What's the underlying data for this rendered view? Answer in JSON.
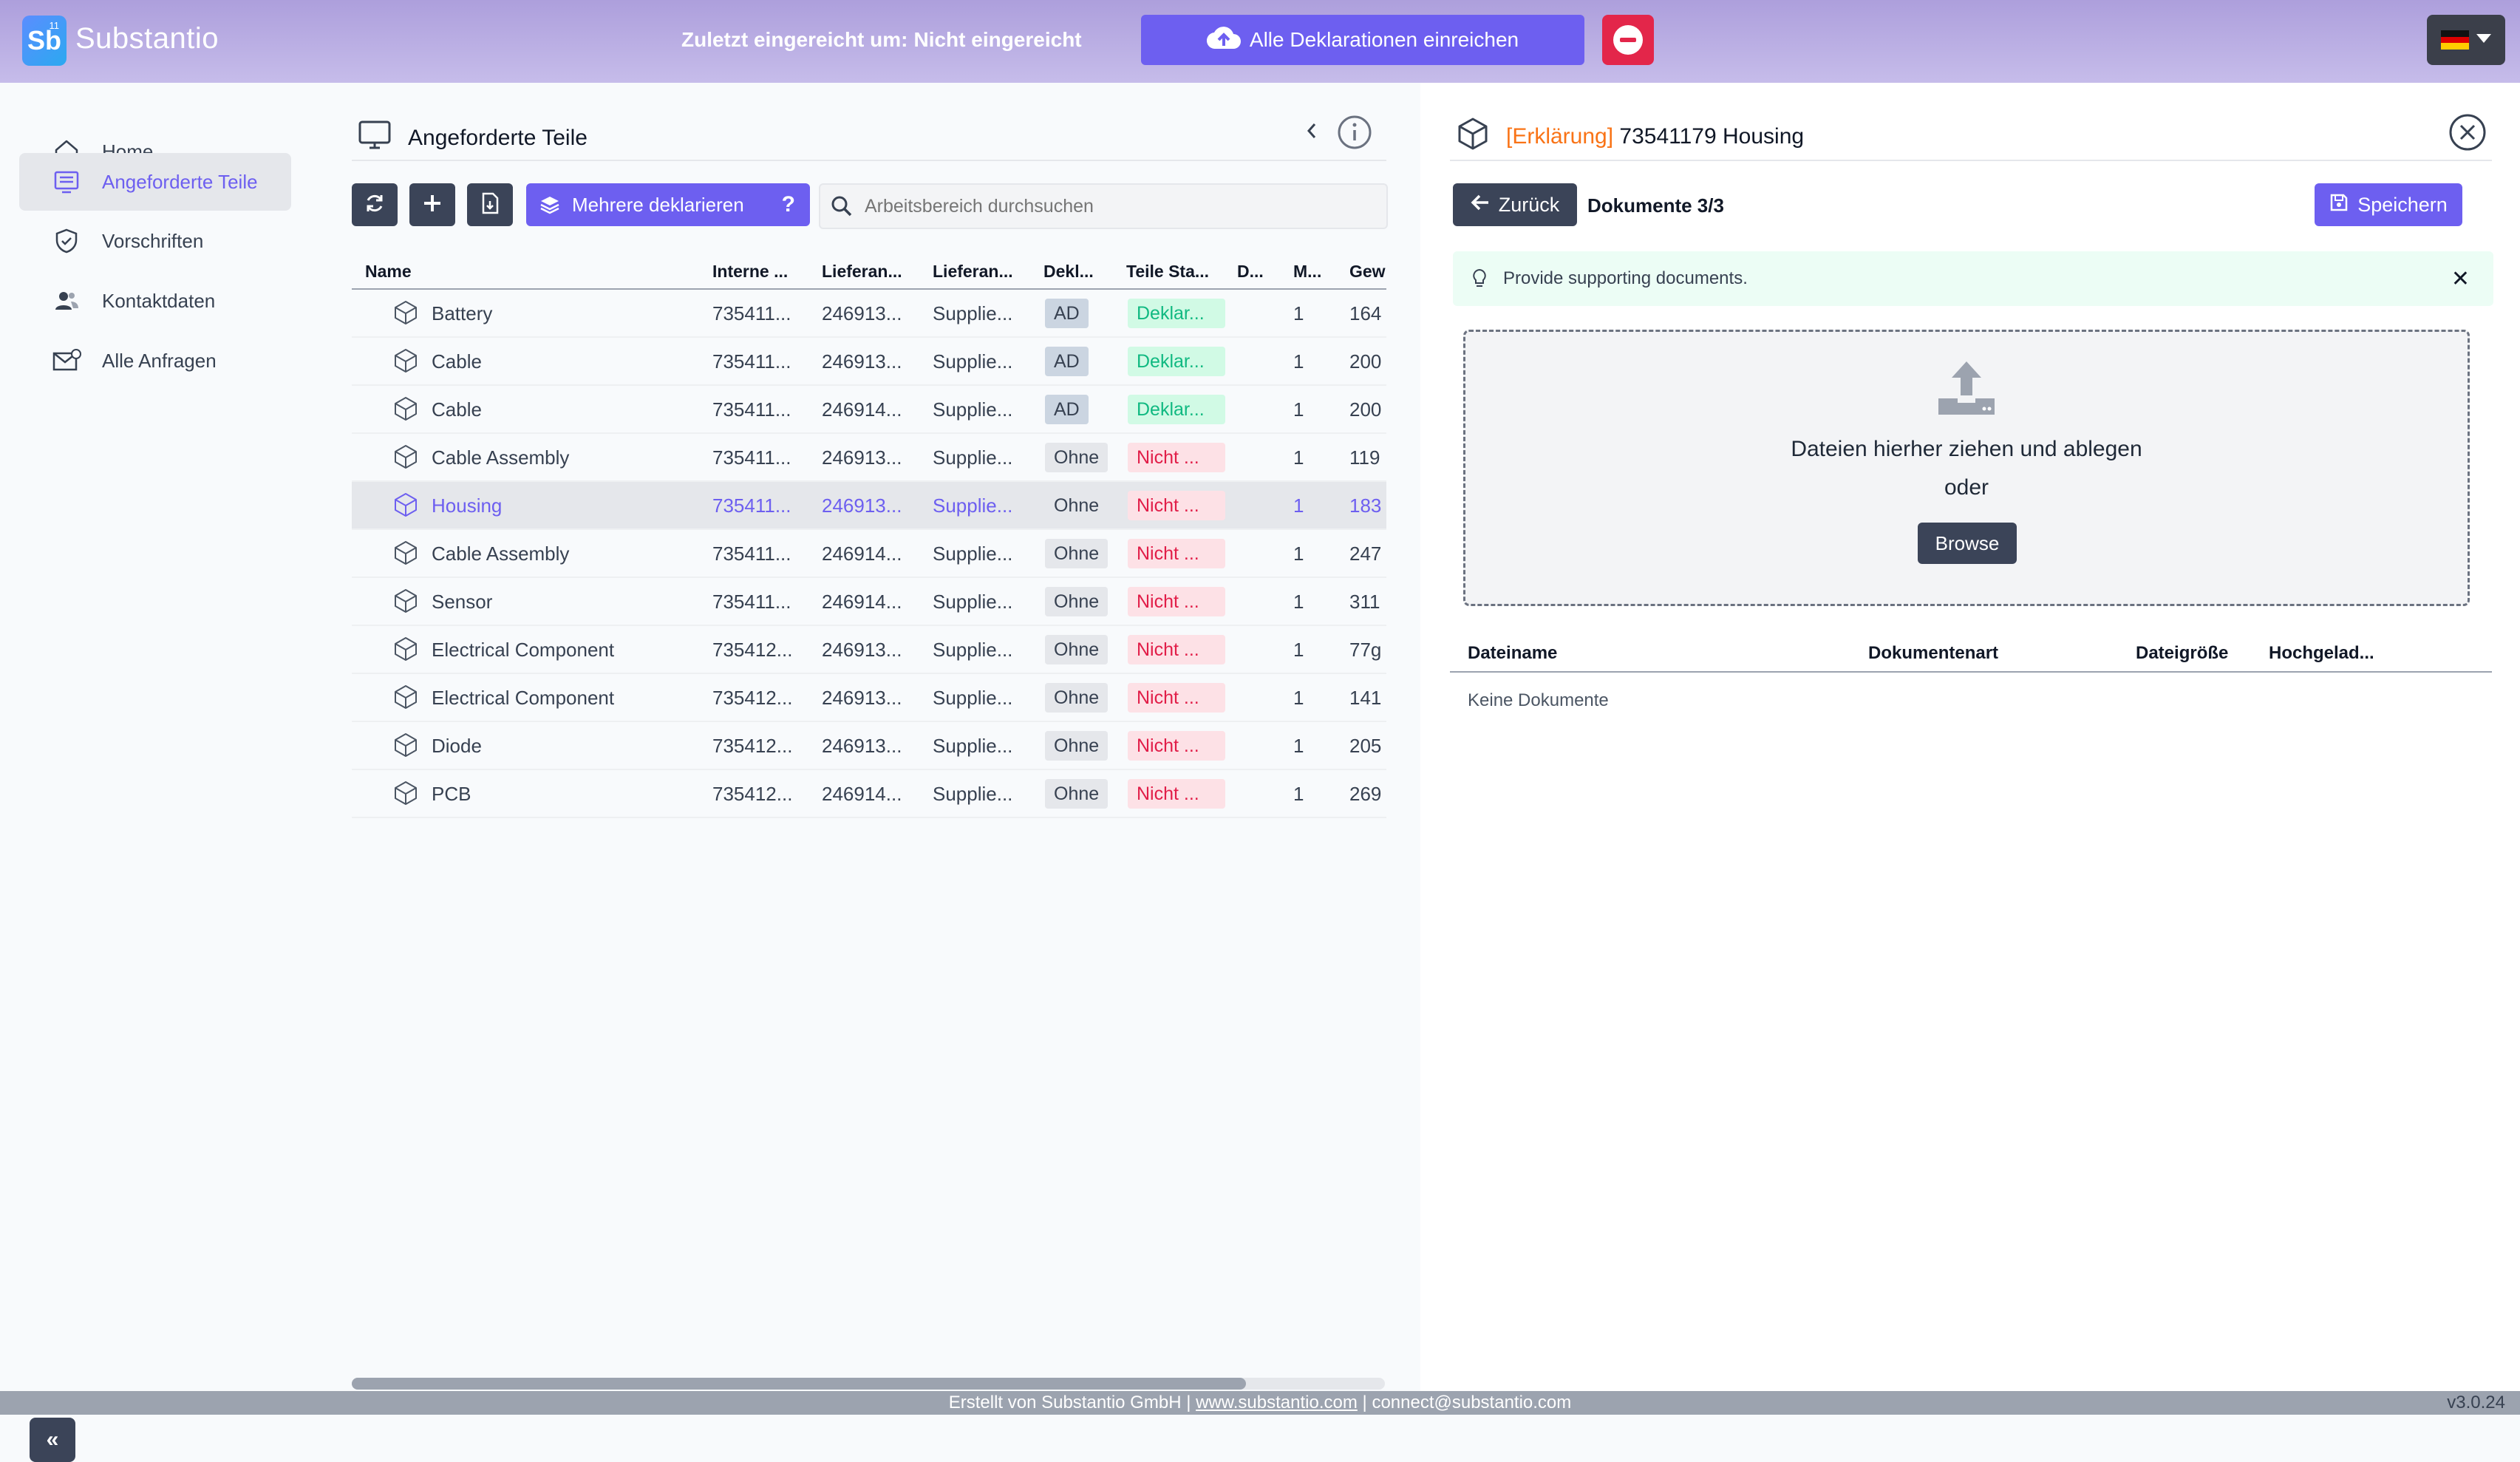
{
  "header": {
    "app_name": "Substantio",
    "logo_letters": "Sb",
    "logo_sup": "11",
    "submitted_label": "Zuletzt eingereicht um:",
    "submitted_value": "Nicht eingereicht",
    "submit_all_label": "Alle Deklarationen einreichen",
    "language": "de"
  },
  "sidebar": {
    "items": [
      {
        "label": "Home",
        "icon": "home-icon"
      },
      {
        "label": "Angeforderte Teile",
        "icon": "list-icon",
        "active": true
      },
      {
        "label": "Vorschriften",
        "icon": "shield-icon"
      },
      {
        "label": "Kontaktdaten",
        "icon": "contacts-icon"
      },
      {
        "label": "Alle Anfragen",
        "icon": "mail-icon"
      }
    ],
    "collapse_glyph": "«"
  },
  "center": {
    "title": "Angeforderte Teile",
    "multi_declare_label": "Mehrere deklarieren",
    "multi_help": "?",
    "search_placeholder": "Arbeitsbereich durchsuchen",
    "columns": [
      "Name",
      "Interne ...",
      "Lieferan...",
      "Lieferan...",
      "Dekl...",
      "Teile Sta...",
      "D...",
      "M...",
      "Gew"
    ],
    "rows": [
      {
        "name": "Battery",
        "internal": "735411...",
        "supplier_no": "246913...",
        "supplier": "Supplie...",
        "decl": "AD",
        "status": "Deklar...",
        "m": "1",
        "weight": "164"
      },
      {
        "name": "Cable",
        "internal": "735411...",
        "supplier_no": "246913...",
        "supplier": "Supplie...",
        "decl": "AD",
        "status": "Deklar...",
        "m": "1",
        "weight": "200"
      },
      {
        "name": "Cable",
        "internal": "735411...",
        "supplier_no": "246914...",
        "supplier": "Supplie...",
        "decl": "AD",
        "status": "Deklar...",
        "m": "1",
        "weight": "200"
      },
      {
        "name": "Cable Assembly",
        "internal": "735411...",
        "supplier_no": "246913...",
        "supplier": "Supplie...",
        "decl": "Ohne",
        "status": "Nicht ...",
        "m": "1",
        "weight": "119"
      },
      {
        "name": "Housing",
        "internal": "735411...",
        "supplier_no": "246913...",
        "supplier": "Supplie...",
        "decl": "Ohne",
        "status": "Nicht ...",
        "m": "1",
        "weight": "183",
        "selected": true
      },
      {
        "name": "Cable Assembly",
        "internal": "735411...",
        "supplier_no": "246914...",
        "supplier": "Supplie...",
        "decl": "Ohne",
        "status": "Nicht ...",
        "m": "1",
        "weight": "247"
      },
      {
        "name": "Sensor",
        "internal": "735411...",
        "supplier_no": "246914...",
        "supplier": "Supplie...",
        "decl": "Ohne",
        "status": "Nicht ...",
        "m": "1",
        "weight": "311"
      },
      {
        "name": "Electrical Component",
        "internal": "735412...",
        "supplier_no": "246913...",
        "supplier": "Supplie...",
        "decl": "Ohne",
        "status": "Nicht ...",
        "m": "1",
        "weight": "77g"
      },
      {
        "name": "Electrical Component",
        "internal": "735412...",
        "supplier_no": "246913...",
        "supplier": "Supplie...",
        "decl": "Ohne",
        "status": "Nicht ...",
        "m": "1",
        "weight": "141"
      },
      {
        "name": "Diode",
        "internal": "735412...",
        "supplier_no": "246913...",
        "supplier": "Supplie...",
        "decl": "Ohne",
        "status": "Nicht ...",
        "m": "1",
        "weight": "205"
      },
      {
        "name": "PCB",
        "internal": "735412...",
        "supplier_no": "246914...",
        "supplier": "Supplie...",
        "decl": "Ohne",
        "status": "Nicht ...",
        "m": "1",
        "weight": "269"
      }
    ]
  },
  "right": {
    "tag": "[Erklärung]",
    "title": "73541179 Housing",
    "back_label": "Zurück",
    "docs_label": "Dokumente 3/3",
    "save_label": "Speichern",
    "hint": "Provide supporting documents.",
    "hint_close": "✕",
    "dropzone_line1": "Dateien hierher ziehen und ablegen",
    "dropzone_line2": "oder",
    "browse_label": "Browse",
    "doc_columns": [
      "Dateiname",
      "Dokumentenart",
      "Dateigröße",
      "Hochgelad..."
    ],
    "empty_text": "Keine Dokumente"
  },
  "footer": {
    "prefix": "Erstellt von Substantio GmbH | ",
    "website": "www.substantio.com",
    "separator": " | ",
    "email": "connect@substantio.com",
    "version": "v3.0.24"
  },
  "colors": {
    "accent": "#6d5ff0",
    "dark_button": "#3b4458",
    "danger": "#e3264a",
    "orange_tag": "#f97316",
    "success": "#10b981"
  }
}
